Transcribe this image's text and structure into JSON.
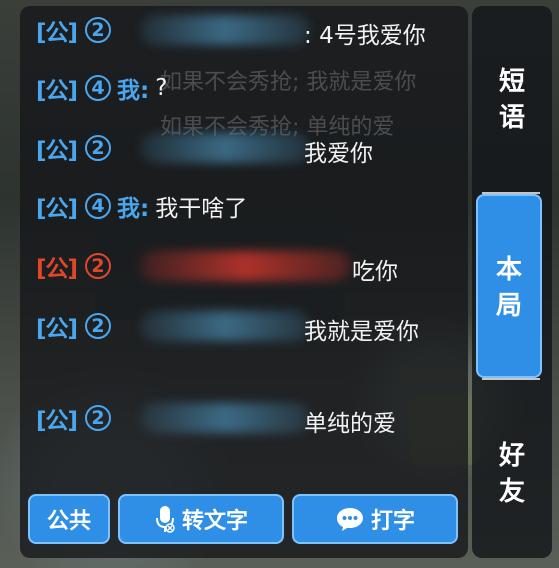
{
  "channel_public": "[公]",
  "self_label": "我:",
  "ghost_lines": [
    "如果不会秀抢; 我就是爱你",
    "如果不会秀抢; 单纯的爱"
  ],
  "messages": [
    {
      "seat": "2",
      "self": false,
      "system": false,
      "text": "4号我爱你"
    },
    {
      "seat": "4",
      "self": true,
      "system": false,
      "text": "?"
    },
    {
      "seat": "2",
      "self": false,
      "system": false,
      "text": "我爱你"
    },
    {
      "seat": "4",
      "self": true,
      "system": false,
      "text": "我干啥了"
    },
    {
      "seat": "2",
      "self": false,
      "system": true,
      "text": "吃你"
    },
    {
      "seat": "2",
      "self": false,
      "system": false,
      "text": "我就是爱你"
    },
    {
      "seat": "2",
      "self": false,
      "system": false,
      "text": "单纯的爱"
    }
  ],
  "bottom_buttons": {
    "public": "公共",
    "voice_to_text": "转文字",
    "type": "打字"
  },
  "side_tabs": {
    "phrases": "短语",
    "this_round": "本局",
    "friends": "好友"
  },
  "colors": {
    "accent_blue": "#2f8ee6",
    "channel_blue": "#4aa6ee",
    "channel_red": "#e0462a"
  },
  "icons": [
    "mic-icon",
    "chat-bubble-icon"
  ]
}
